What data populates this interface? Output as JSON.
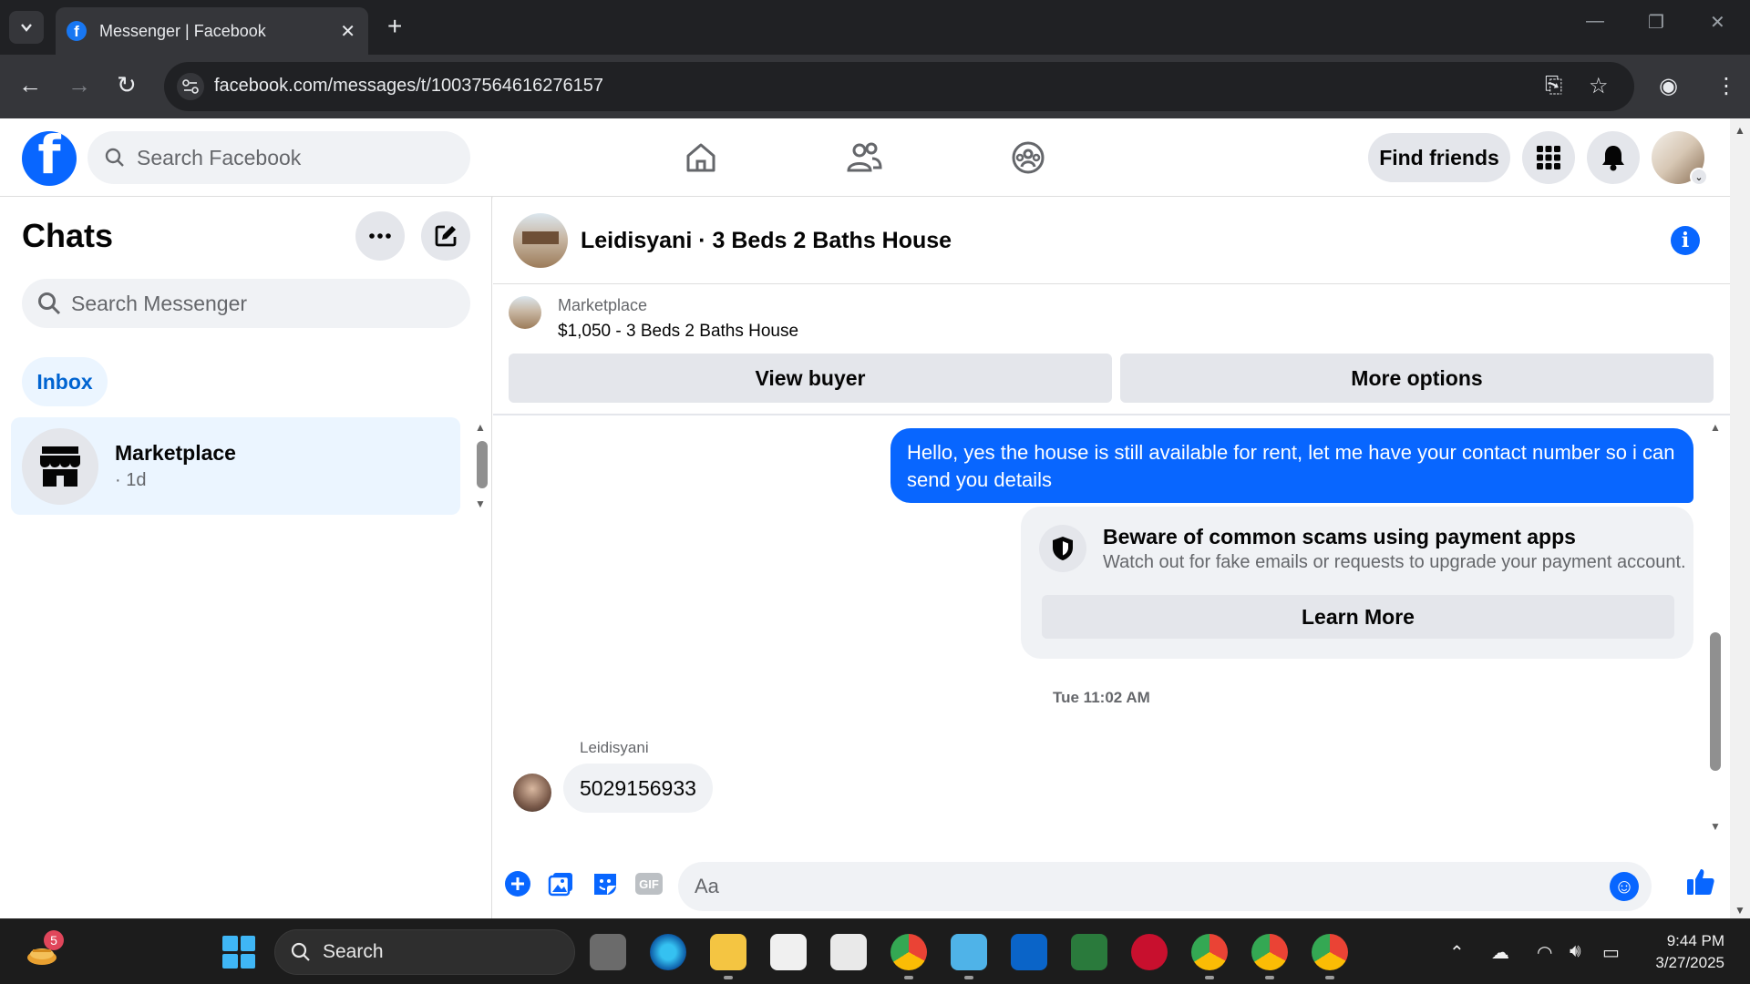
{
  "browser": {
    "tab_title": "Messenger | Facebook",
    "url": "facebook.com/messages/t/10037564616276157"
  },
  "header": {
    "search_placeholder": "Search Facebook",
    "find_friends": "Find friends"
  },
  "sidebar": {
    "title": "Chats",
    "search_placeholder": "Search Messenger",
    "inbox_label": "Inbox",
    "chats": [
      {
        "name": "Marketplace",
        "time": "· 1d"
      }
    ]
  },
  "conversation": {
    "title": "Leidisyani · 3 Beds 2 Baths House",
    "marketplace": {
      "label": "Marketplace",
      "listing": "$1,050 - 3 Beds 2 Baths House",
      "view_buyer": "View buyer",
      "more_options": "More options"
    },
    "outgoing_message": "Hello, yes the house is still available for rent, let me have your contact number so i can send you  details",
    "scam_notice": {
      "title": "Beware of common scams using payment apps",
      "subtitle": "Watch out for fake emails or requests to upgrade your payment account.",
      "button": "Learn More"
    },
    "timestamp": "Tue 11:02 AM",
    "sender_name": "Leidisyani",
    "incoming_message": "5029156933",
    "composer_placeholder": "Aa"
  },
  "taskbar": {
    "widget_badge": "5",
    "search_placeholder": "Search",
    "time": "9:44 PM",
    "date": "3/27/2025"
  },
  "colors": {
    "facebook_blue": "#0866ff",
    "selected_bg": "#ebf5ff",
    "bubble_gray": "#f0f2f5"
  }
}
